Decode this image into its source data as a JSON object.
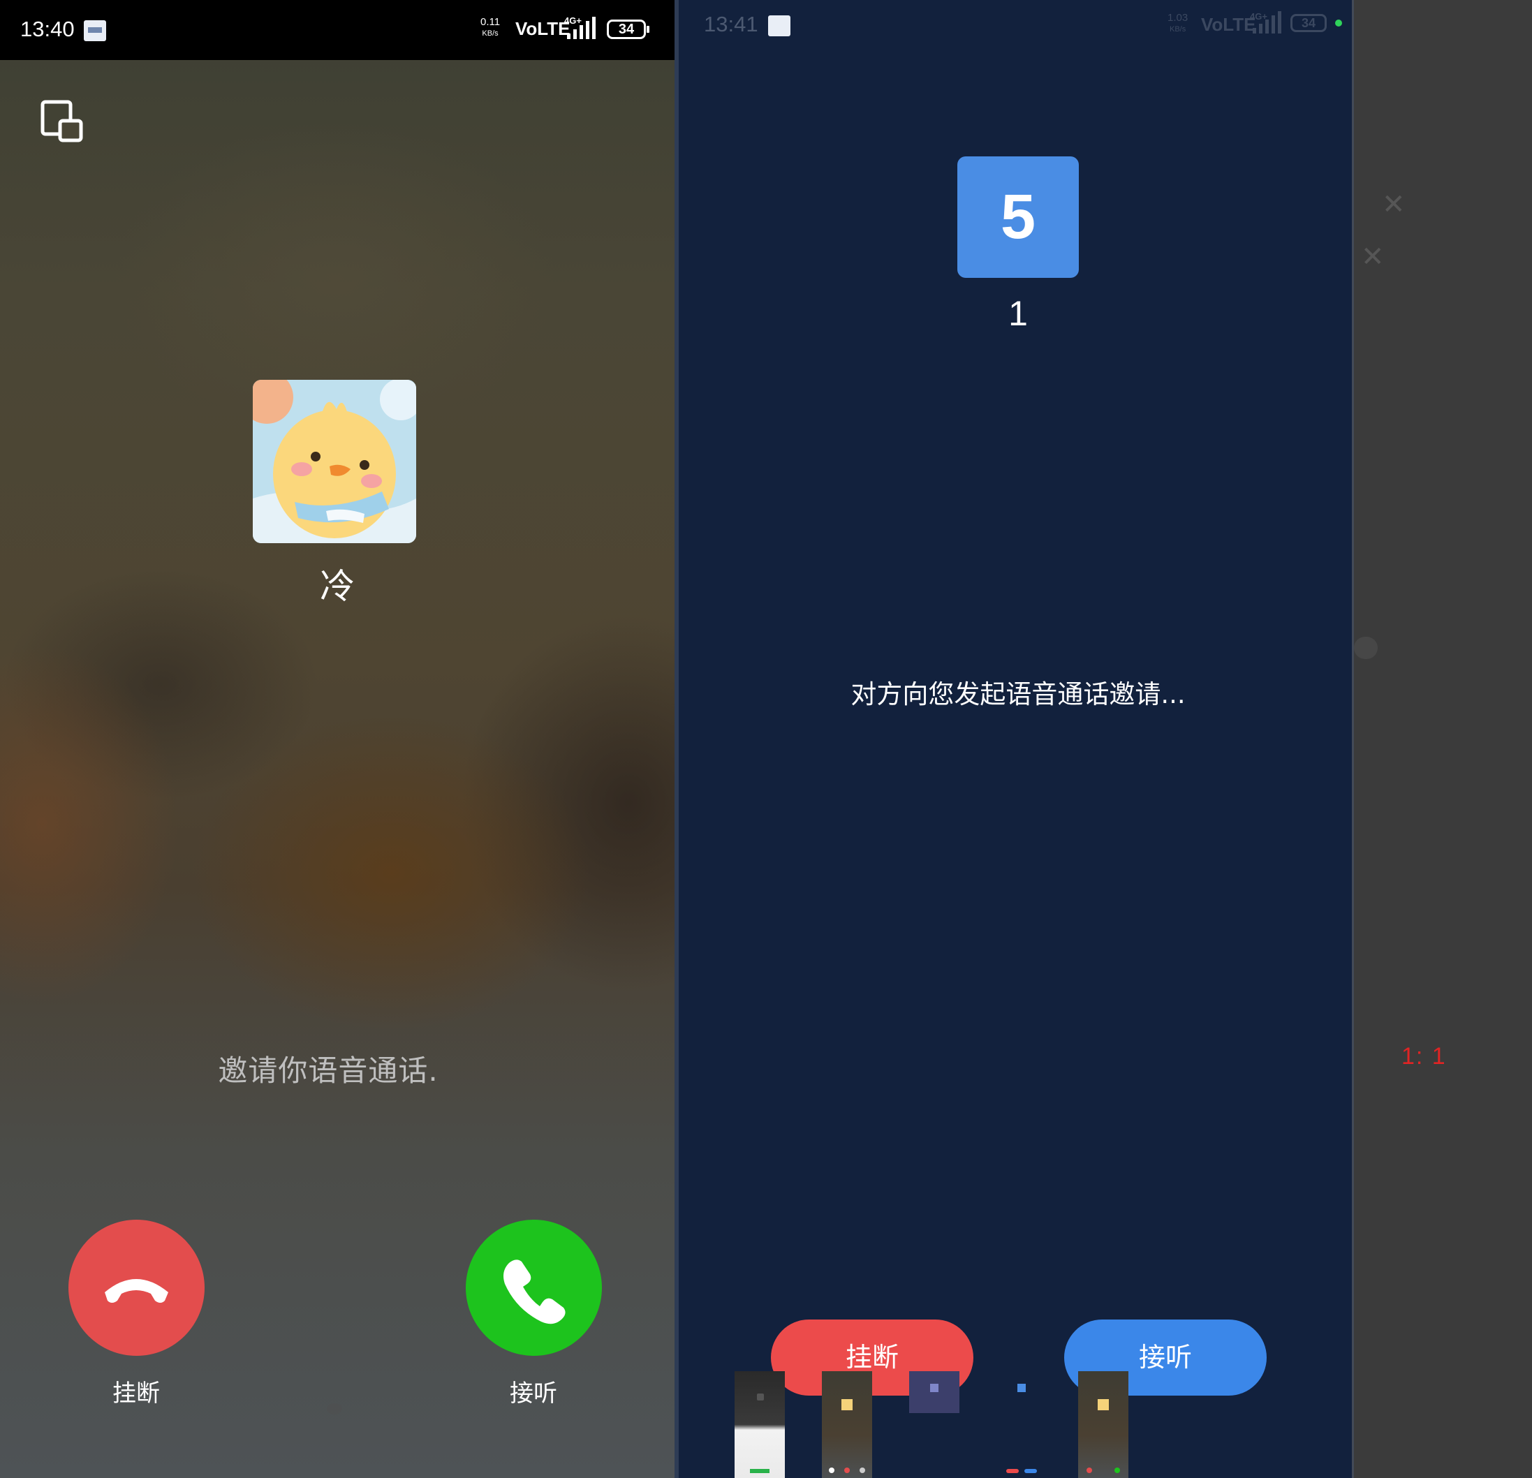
{
  "left_phone": {
    "status_bar": {
      "time": "13:40",
      "speed_value": "0.11",
      "speed_unit": "KB/s",
      "network": "VoLTE",
      "cell": "4G+",
      "battery": "34"
    },
    "caller": {
      "name": "冷",
      "avatar_icon": "cartoon-chick-avatar"
    },
    "invite_text": "邀请你语音通话.",
    "hangup_label": "挂断",
    "answer_label": "接听",
    "colors": {
      "hangup": "#e34d4d",
      "answer": "#1dc31d"
    }
  },
  "right_phone": {
    "status_bar": {
      "time": "13:41",
      "speed_value": "1.03",
      "speed_unit": "KB/s",
      "network": "VoLTE",
      "cell": "4G+",
      "battery": "34"
    },
    "caller": {
      "avatar_text": "5",
      "name": "1"
    },
    "invite_text": "对方向您发起语音通话邀请...",
    "hangup_label": "挂断",
    "answer_label": "接听",
    "colors": {
      "background": "#12213d",
      "avatar": "#4a8de4",
      "hangup": "#ec4b4b",
      "answer": "#3b87e9"
    }
  },
  "edge_panel": {
    "ratio_label": "1: 1"
  }
}
